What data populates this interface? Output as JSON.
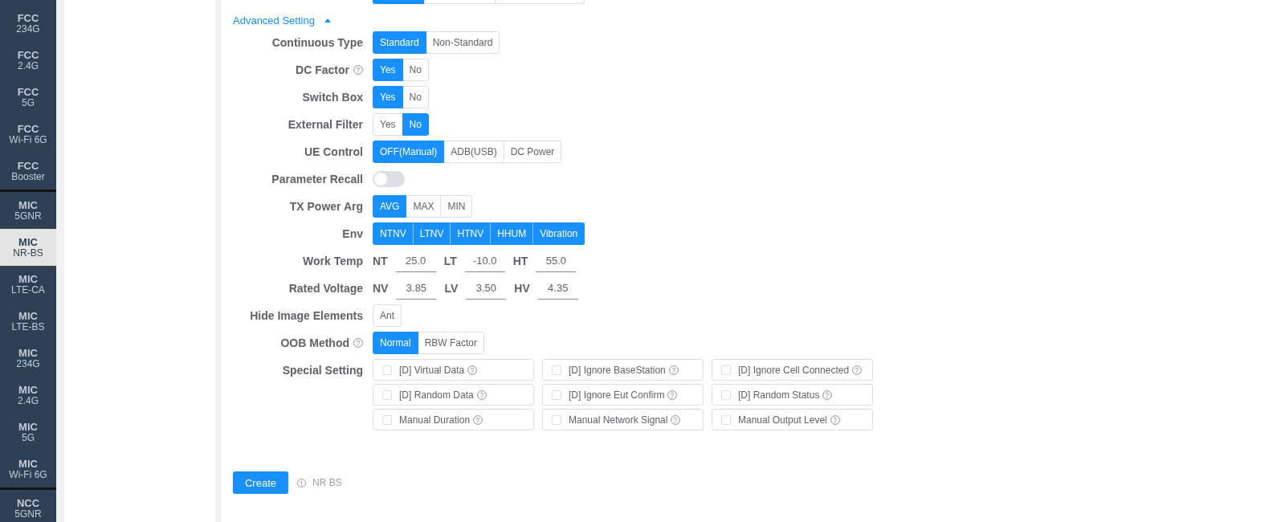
{
  "sidebar": {
    "groups": [
      {
        "items": [
          {
            "title": "FCC",
            "subtitle": "234G",
            "selected": false
          },
          {
            "title": "FCC",
            "subtitle": "2.4G",
            "selected": false
          },
          {
            "title": "FCC",
            "subtitle": "5G",
            "selected": false
          },
          {
            "title": "FCC",
            "subtitle": "Wi-Fi 6G",
            "selected": false
          },
          {
            "title": "FCC",
            "subtitle": "Booster",
            "selected": false
          }
        ]
      },
      {
        "items": [
          {
            "title": "MIC",
            "subtitle": "5GNR",
            "selected": false
          },
          {
            "title": "MIC",
            "subtitle": "NR-BS",
            "selected": true
          },
          {
            "title": "MIC",
            "subtitle": "LTE-CA",
            "selected": false
          },
          {
            "title": "MIC",
            "subtitle": "LTE-BS",
            "selected": false
          },
          {
            "title": "MIC",
            "subtitle": "234G",
            "selected": false
          },
          {
            "title": "MIC",
            "subtitle": "2.4G",
            "selected": false
          },
          {
            "title": "MIC",
            "subtitle": "5G",
            "selected": false
          },
          {
            "title": "MIC",
            "subtitle": "Wi-Fi 6G",
            "selected": false
          }
        ]
      },
      {
        "items": [
          {
            "title": "NCC",
            "subtitle": "5GNR",
            "selected": false
          }
        ]
      }
    ]
  },
  "form": {
    "partial_option_group": {
      "options": [
        {
          "selected": true
        },
        {
          "selected": false
        },
        {
          "selected": false
        }
      ]
    },
    "advanced_setting": {
      "label": "Advanced Setting",
      "expanded": true
    },
    "rows": [
      {
        "label": "Continuous Type",
        "kind": "segmented",
        "options": [
          {
            "label": "Standard",
            "selected": true
          },
          {
            "label": "Non-Standard",
            "selected": false
          }
        ]
      },
      {
        "label": "DC Factor",
        "kind": "segmented",
        "help": true,
        "options": [
          {
            "label": "Yes",
            "selected": true
          },
          {
            "label": "No",
            "selected": false
          }
        ]
      },
      {
        "label": "Switch Box",
        "kind": "segmented",
        "options": [
          {
            "label": "Yes",
            "selected": true
          },
          {
            "label": "No",
            "selected": false
          }
        ]
      },
      {
        "label": "External Filter",
        "kind": "segmented",
        "options": [
          {
            "label": "Yes",
            "selected": false
          },
          {
            "label": "No",
            "selected": true
          }
        ]
      },
      {
        "label": "UE Control",
        "kind": "segmented",
        "options": [
          {
            "label": "OFF(Manual)",
            "selected": true
          },
          {
            "label": "ADB(USB)",
            "selected": false
          },
          {
            "label": "DC Power",
            "selected": false
          }
        ]
      },
      {
        "label": "Parameter Recall",
        "kind": "switch",
        "on": false
      },
      {
        "label": "TX Power Arg",
        "kind": "segmented",
        "options": [
          {
            "label": "AVG",
            "selected": true
          },
          {
            "label": "MAX",
            "selected": false
          },
          {
            "label": "MIN",
            "selected": false
          }
        ]
      },
      {
        "label": "Env",
        "kind": "segmented",
        "options": [
          {
            "label": "NTNV",
            "selected": true
          },
          {
            "label": "LTNV",
            "selected": true
          },
          {
            "label": "HTNV",
            "selected": true
          },
          {
            "label": "HHUM",
            "selected": true
          },
          {
            "label": "Vibration",
            "selected": true
          }
        ]
      },
      {
        "label": "Work Temp",
        "kind": "inputs",
        "fields": [
          {
            "label": "NT",
            "value": "25.0"
          },
          {
            "label": "LT",
            "value": "-10.0"
          },
          {
            "label": "HT",
            "value": "55.0"
          }
        ]
      },
      {
        "label": "Rated Voltage",
        "kind": "inputs",
        "fields": [
          {
            "label": "NV",
            "value": "3.85"
          },
          {
            "label": "LV",
            "value": "3.50"
          },
          {
            "label": "HV",
            "value": "4.35"
          }
        ]
      },
      {
        "label": "Hide Image Elements",
        "kind": "segmented",
        "options": [
          {
            "label": "Ant",
            "selected": false
          }
        ]
      },
      {
        "label": "OOB Method",
        "kind": "segmented",
        "help": true,
        "options": [
          {
            "label": "Normal",
            "selected": true
          },
          {
            "label": "RBW Factor",
            "selected": false
          }
        ]
      },
      {
        "label": "Special Setting",
        "kind": "checkboxes",
        "options": [
          {
            "label": "[D] Virtual Data",
            "checked": false,
            "help": true
          },
          {
            "label": "[D] Ignore BaseStation",
            "checked": false,
            "help": true
          },
          {
            "label": "[D] Ignore Cell Connected",
            "checked": false,
            "help": true
          },
          {
            "label": "[D] Random Data",
            "checked": false,
            "help": true
          },
          {
            "label": "[D] Ignore Eut Confirm",
            "checked": false,
            "help": true
          },
          {
            "label": "[D] Random Status",
            "checked": false,
            "help": true
          },
          {
            "label": "Manual Duration",
            "checked": false,
            "help": true
          },
          {
            "label": "Manual Network Signal",
            "checked": false,
            "help": true
          },
          {
            "label": "Manual Output Level",
            "checked": false,
            "help": true
          }
        ]
      }
    ]
  },
  "footer": {
    "create_button": "Create",
    "note": "NR BS"
  }
}
